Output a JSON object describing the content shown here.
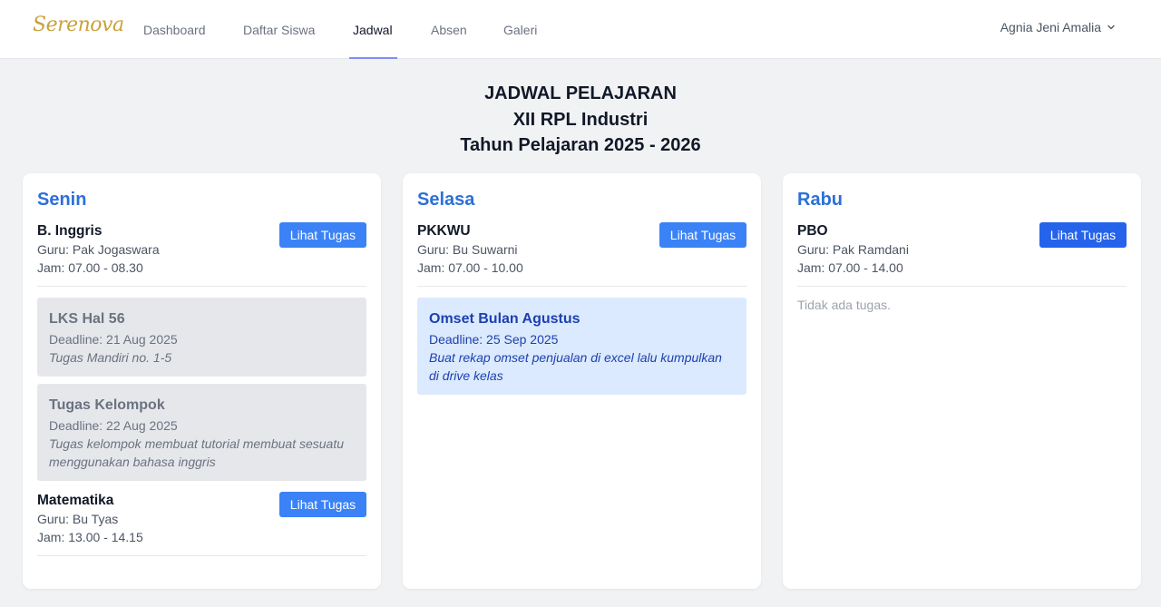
{
  "app": {
    "logo": "Serenova"
  },
  "nav": {
    "links": [
      "Dashboard",
      "Daftar Siswa",
      "Jadwal",
      "Absen",
      "Galeri"
    ],
    "active": "Jadwal",
    "user": "Agnia Jeni Amalia"
  },
  "header": {
    "line1": "JADWAL PELAJARAN",
    "line2": "XII RPL Industri",
    "line3": "Tahun Pelajaran 2025 - 2026"
  },
  "days": [
    {
      "name": "Senin",
      "subjects": [
        {
          "name": "B. Inggris",
          "teacher": "Guru: Pak Jogaswara",
          "time": "Jam: 07.00 - 08.30",
          "button": "Lihat Tugas",
          "tasks": [
            {
              "title": "LKS Hal 56",
              "deadline": "Deadline: 21 Aug 2025",
              "desc": "Tugas Mandiri no. 1-5",
              "status": "done"
            },
            {
              "title": "Tugas Kelompok",
              "deadline": "Deadline: 22 Aug 2025",
              "desc": "Tugas kelompok membuat tutorial membuat sesuatu menggunakan bahasa inggris",
              "status": "done"
            }
          ]
        },
        {
          "name": "Matematika",
          "teacher": "Guru: Bu Tyas",
          "time": "Jam: 13.00 - 14.15",
          "button": "Lihat Tugas",
          "tasks": []
        }
      ]
    },
    {
      "name": "Selasa",
      "subjects": [
        {
          "name": "PKKWU",
          "teacher": "Guru: Bu Suwarni",
          "time": "Jam: 07.00 - 10.00",
          "button": "Lihat Tugas",
          "tasks": [
            {
              "title": "Omset Bulan Agustus",
              "deadline": "Deadline: 25 Sep 2025",
              "desc": "Buat rekap omset penjualan di excel lalu kumpulkan di drive kelas",
              "status": "active"
            }
          ]
        }
      ]
    },
    {
      "name": "Rabu",
      "subjects": [
        {
          "name": "PBO",
          "teacher": "Guru: Pak Ramdani",
          "time": "Jam: 07.00 - 14.00",
          "button": "Lihat Tugas",
          "tasks": [],
          "empty_text": "Tidak ada tugas."
        }
      ]
    }
  ],
  "colors": {
    "accent": "#2d6fd9",
    "button": "#3b82f6",
    "button_active": "#2563eb",
    "logo": "#c9a23c"
  }
}
